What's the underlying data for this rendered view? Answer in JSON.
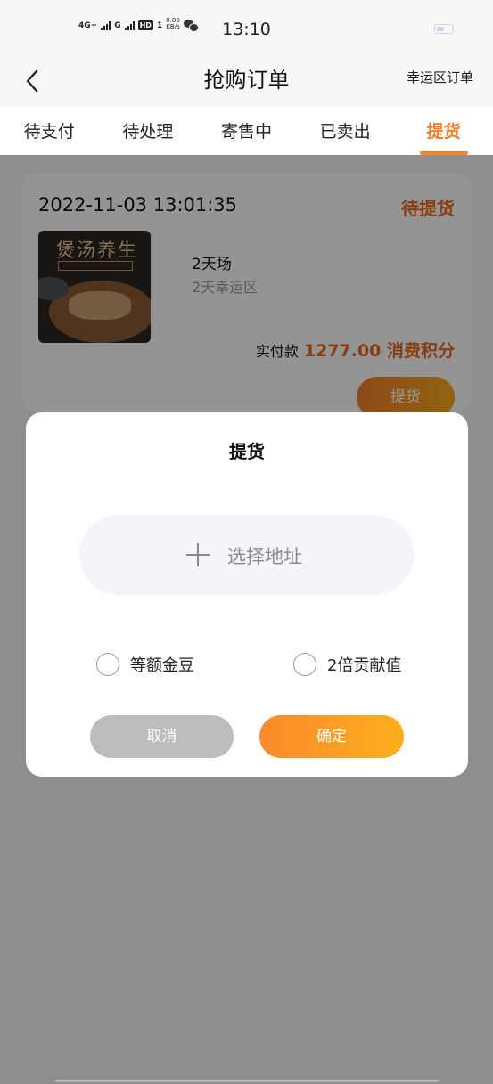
{
  "status_bar": {
    "network_1": "4G+",
    "network_2": "G",
    "hd_badge": "HD",
    "sim_index": "1",
    "net_speed_value": "0.00",
    "net_speed_unit": "KB/s",
    "time": "13:10"
  },
  "header": {
    "title": "抢购订单",
    "right_link": "幸运区订单"
  },
  "tabs": [
    {
      "label": "待支付",
      "active": false
    },
    {
      "label": "待处理",
      "active": false
    },
    {
      "label": "寄售中",
      "active": false
    },
    {
      "label": "已卖出",
      "active": false
    },
    {
      "label": "提货",
      "active": true
    }
  ],
  "order": {
    "time": "2022-11-03 13:01:35",
    "status": "待提货",
    "thumbnail_text": "煲汤养生",
    "product_name": "2天场",
    "product_zone": "2天幸运区",
    "paid_label": "实付款",
    "paid_amount": "1277.00 消费积分",
    "action_label": "提货"
  },
  "modal": {
    "title": "提货",
    "address_placeholder": "选择地址",
    "options": [
      {
        "label": "等额金豆",
        "selected": false
      },
      {
        "label": "2倍贡献值",
        "selected": false
      }
    ],
    "cancel_label": "取消",
    "confirm_label": "确定"
  },
  "colors": {
    "accent": "#f07d2a",
    "button_gradient_start": "#fb8a2c",
    "button_gradient_end": "#fdae1d",
    "cancel_gray": "#bdbdbd"
  }
}
